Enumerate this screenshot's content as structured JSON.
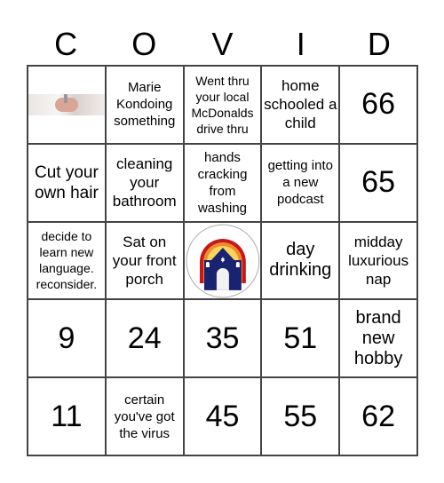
{
  "header": {
    "letters": [
      "C",
      "O",
      "V",
      "I",
      "D"
    ]
  },
  "cells": [
    "",
    "Marie Kondoing something",
    "Went thru your local McDonalds drive thru",
    "home schooled a child",
    "66",
    "Cut your own hair",
    "cleaning your bathroom",
    "hands cracking from washing",
    "getting into a new podcast",
    "65",
    "decide to learn new language. reconsider.",
    "Sat on your front porch",
    "",
    "day drinking",
    "midday luxurious nap",
    "9",
    "24",
    "35",
    "51",
    "brand new hobby",
    "11",
    "certain you've got the virus",
    "45",
    "55",
    "62"
  ],
  "icons": {
    "cell_0": "hand-washing-image",
    "free_space": "synagogue-rainbow-logo"
  },
  "colors": {
    "logo_navy": "#1a2370",
    "logo_red": "#c8161d",
    "logo_orange": "#f08a2c",
    "logo_yellow": "#f9d45e"
  }
}
